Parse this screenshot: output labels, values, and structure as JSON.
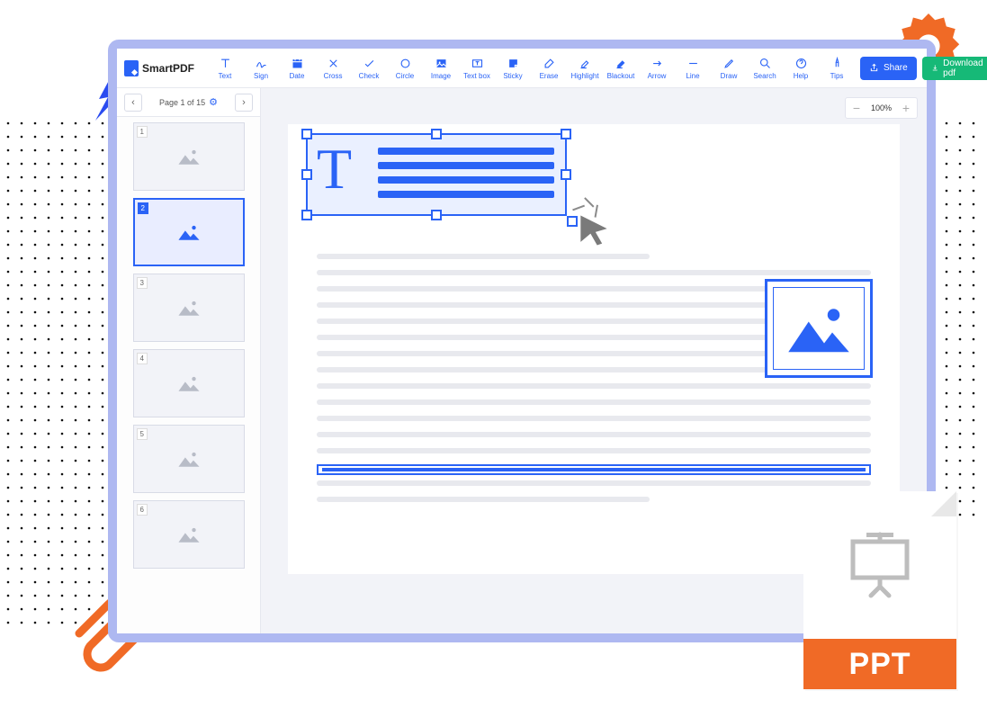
{
  "brand": {
    "name": "SmartPDF"
  },
  "toolbar": {
    "tools": [
      {
        "id": "text",
        "label": "Text"
      },
      {
        "id": "sign",
        "label": "Sign"
      },
      {
        "id": "date",
        "label": "Date"
      },
      {
        "id": "cross",
        "label": "Cross"
      },
      {
        "id": "check",
        "label": "Check"
      },
      {
        "id": "circle",
        "label": "Circle"
      },
      {
        "id": "image",
        "label": "Image"
      },
      {
        "id": "textbox",
        "label": "Text box"
      },
      {
        "id": "sticky",
        "label": "Sticky"
      },
      {
        "id": "erase",
        "label": "Erase"
      },
      {
        "id": "highlight",
        "label": "Highlight"
      },
      {
        "id": "blackout",
        "label": "Blackout"
      },
      {
        "id": "arrow",
        "label": "Arrow"
      },
      {
        "id": "line",
        "label": "Line"
      },
      {
        "id": "draw",
        "label": "Draw"
      }
    ],
    "utils": [
      {
        "id": "search",
        "label": "Search"
      },
      {
        "id": "help",
        "label": "Help"
      },
      {
        "id": "tips",
        "label": "Tips"
      }
    ],
    "share_label": "Share",
    "download_label": "Download pdf"
  },
  "pager": {
    "label": "Page 1 of 15",
    "prev": "‹",
    "next": "›"
  },
  "zoom": {
    "value": "100%",
    "minus": "−",
    "plus": "+"
  },
  "thumbnails": [
    {
      "num": "1"
    },
    {
      "num": "2"
    },
    {
      "num": "3"
    },
    {
      "num": "4"
    },
    {
      "num": "5"
    },
    {
      "num": "6"
    }
  ],
  "ppt_badge": {
    "label": "PPT"
  },
  "colors": {
    "primary": "#2a63f6",
    "green": "#16b977",
    "orange": "#f06a26"
  },
  "active_thumb_index": 1
}
